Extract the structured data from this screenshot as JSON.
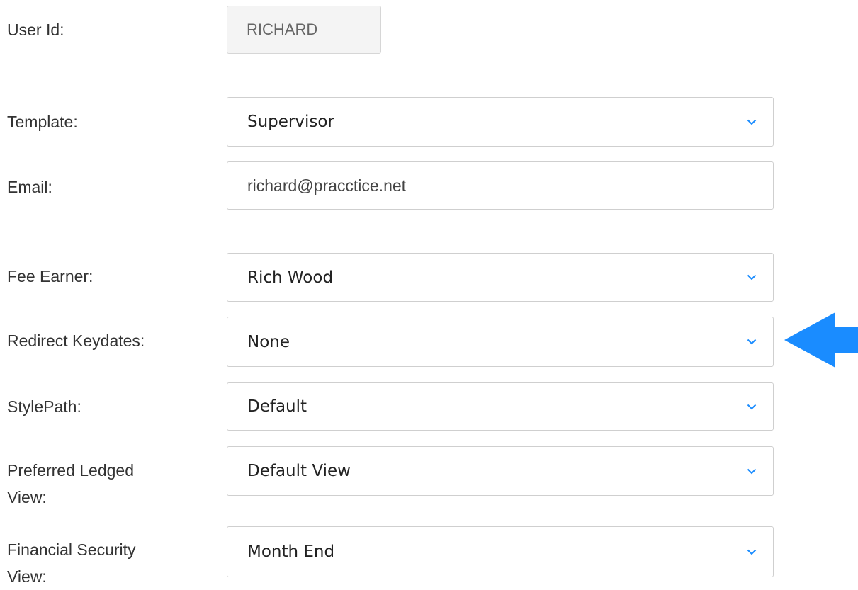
{
  "user_id": {
    "label": "User Id:",
    "value": "RICHARD"
  },
  "template": {
    "label": "Template:",
    "value": "Supervisor"
  },
  "email": {
    "label": "Email:",
    "value": "richard@pracctice.net"
  },
  "fee_earner": {
    "label": "Fee Earner:",
    "value": "Rich Wood"
  },
  "redirect_keydates": {
    "label": "Redirect Keydates:",
    "value": "None"
  },
  "style_path": {
    "label": "StylePath:",
    "value": "Default"
  },
  "preferred_ledger_view": {
    "label_line1": "Preferred Ledged",
    "label_line2": "View:",
    "value": "Default View"
  },
  "financial_security_view": {
    "label_line1": "Financial Security",
    "label_line2": "View:",
    "value": "Month End"
  },
  "icons": {
    "dropdown": "chevron-down-icon",
    "pointer": "arrow-left-icon"
  },
  "colors": {
    "accent": "#1a8cff",
    "border": "#cfcfcf",
    "readonly_bg": "#f4f4f4"
  }
}
